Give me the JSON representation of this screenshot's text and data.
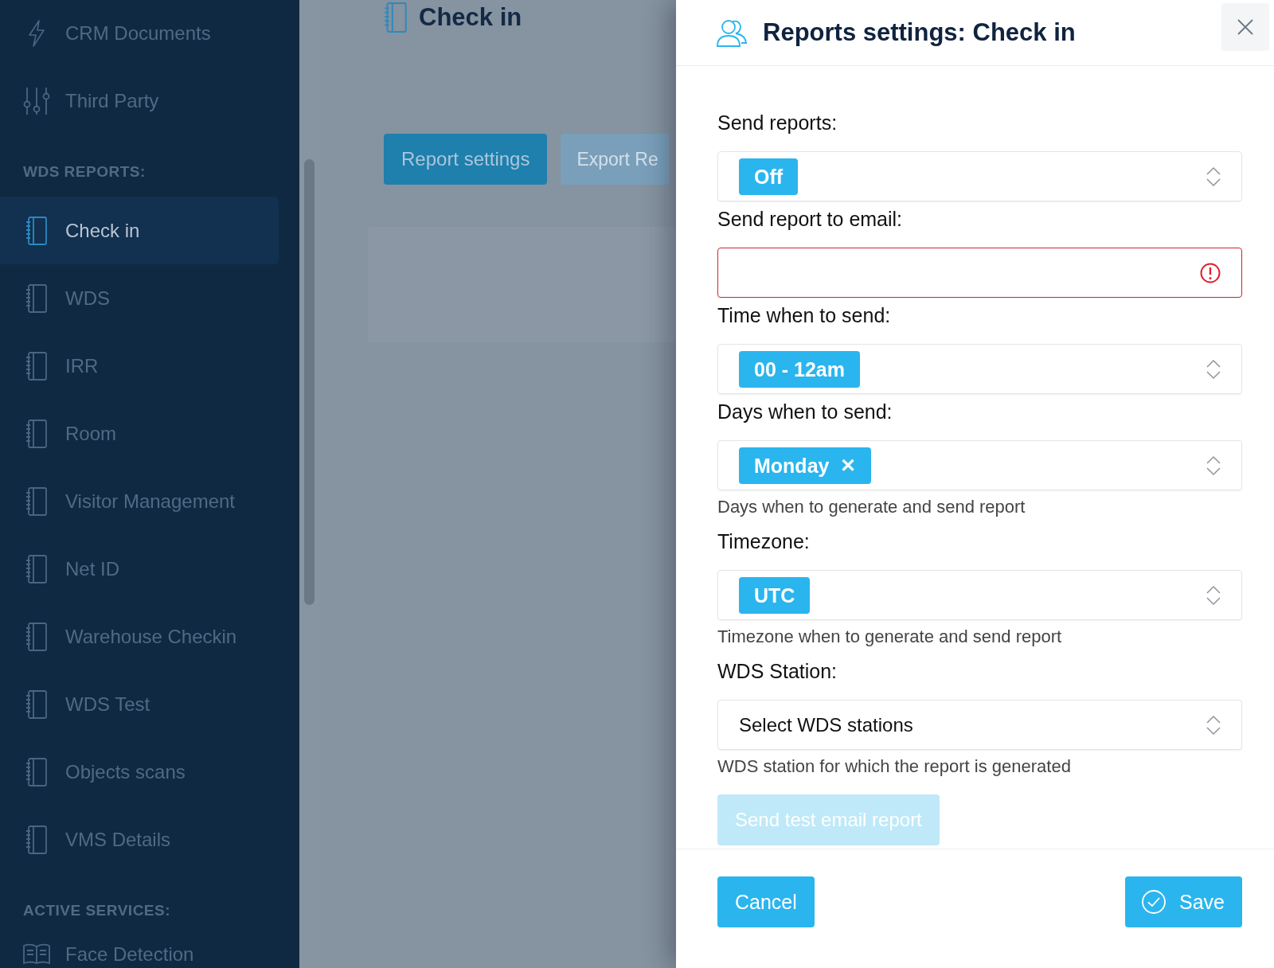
{
  "sidebar": {
    "entries": [
      {
        "kind": "action",
        "label": "CRM Documents",
        "selected": false
      },
      {
        "kind": "integration",
        "label": "Third Party",
        "selected": false
      },
      {
        "kind": "header",
        "label": "WDS REPORTS:"
      },
      {
        "kind": "report",
        "label": "Check in",
        "selected": true
      },
      {
        "kind": "report",
        "label": "WDS",
        "selected": false
      },
      {
        "kind": "report",
        "label": "IRR",
        "selected": false
      },
      {
        "kind": "report",
        "label": "Room",
        "selected": false
      },
      {
        "kind": "report",
        "label": "Visitor Management",
        "selected": false
      },
      {
        "kind": "report",
        "label": "Net ID",
        "selected": false
      },
      {
        "kind": "report",
        "label": "Warehouse Checkin",
        "selected": false
      },
      {
        "kind": "report",
        "label": "WDS Test",
        "selected": false
      },
      {
        "kind": "report",
        "label": "Objects scans",
        "selected": false
      },
      {
        "kind": "report",
        "label": "VMS Details",
        "selected": false
      },
      {
        "kind": "header",
        "label": "ACTIVE SERVICES:"
      },
      {
        "kind": "service",
        "label": "Face Detection",
        "selected": false
      }
    ]
  },
  "page": {
    "title": "Check in",
    "buttons": [
      {
        "label": "Report settings",
        "disabled": false
      },
      {
        "label": "Export Re",
        "disabled": true
      }
    ]
  },
  "dialog": {
    "title": "Reports settings: Check in",
    "fields": [
      {
        "kind": "select",
        "label": "Send reports:",
        "chips": [
          "Off"
        ]
      },
      {
        "kind": "text",
        "label": "Send report to email:",
        "error": true
      },
      {
        "kind": "select",
        "label": "Time when to send:",
        "chips": [
          "00 - 12am"
        ]
      },
      {
        "kind": "multiselect",
        "label": "Days when to send:",
        "chips": [
          "Monday"
        ],
        "remove": "✕",
        "help": "Days when to generate and send report"
      },
      {
        "kind": "select",
        "label": "Timezone:",
        "chips": [
          "UTC"
        ],
        "help": "Timezone when to generate and send report"
      },
      {
        "kind": "select",
        "label": "WDS Station:",
        "placeholder": "Select WDS stations",
        "help": "WDS station for which the report is generated"
      }
    ],
    "test_button": {
      "label": "Send test email report",
      "disabled": true
    },
    "cancel": "Cancel",
    "save": "Save"
  }
}
